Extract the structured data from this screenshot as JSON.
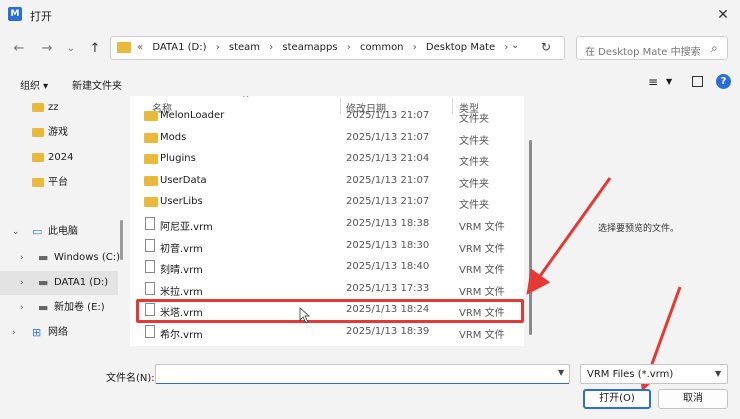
{
  "window": {
    "title": "打开",
    "app_icon_glyph": "M",
    "close_glyph": "✕"
  },
  "nav": {
    "back": "←",
    "forward": "→",
    "recent": "⌄",
    "up": "↑"
  },
  "address": {
    "crumbs": [
      "«",
      "DATA1 (D:)",
      "›",
      "steam",
      "›",
      "steamapps",
      "›",
      "common",
      "›",
      "Desktop Mate",
      "›"
    ],
    "dropdown": "⌄",
    "refresh": "↻"
  },
  "search": {
    "placeholder": "在 Desktop Mate 中搜索",
    "icon": "⌕"
  },
  "toolbar": {
    "organize": "组织 ▾",
    "new_folder": "新建文件夹",
    "view_glyph": "≡",
    "view_dd": "▼",
    "help_glyph": "?"
  },
  "sidebar": {
    "items": [
      {
        "label": "zz",
        "icon": "folder",
        "arrow": ""
      },
      {
        "label": "游戏",
        "icon": "folder",
        "arrow": ""
      },
      {
        "label": "2024",
        "icon": "folder",
        "arrow": ""
      },
      {
        "label": "平台",
        "icon": "folder",
        "arrow": ""
      },
      {
        "label": "此电脑",
        "icon": "computer",
        "arrow": "⌄"
      },
      {
        "label": "Windows (C:)",
        "icon": "drive",
        "arrow": "›"
      },
      {
        "label": "DATA1 (D:)",
        "icon": "drive",
        "arrow": "›"
      },
      {
        "label": "新加卷 (E:)",
        "icon": "drive",
        "arrow": "›"
      },
      {
        "label": "网络",
        "icon": "network",
        "arrow": "›"
      }
    ]
  },
  "list": {
    "headers": {
      "name": "名称",
      "date": "修改日期",
      "type": "类型"
    },
    "sort_glyph": "^",
    "rows": [
      {
        "name": "MelonLoader",
        "date": "2025/1/13 21:07",
        "type": "文件夹",
        "kind": "folder"
      },
      {
        "name": "Mods",
        "date": "2025/1/13 21:07",
        "type": "文件夹",
        "kind": "folder"
      },
      {
        "name": "Plugins",
        "date": "2025/1/13 21:04",
        "type": "文件夹",
        "kind": "folder"
      },
      {
        "name": "UserData",
        "date": "2025/1/13 21:07",
        "type": "文件夹",
        "kind": "folder"
      },
      {
        "name": "UserLibs",
        "date": "2025/1/13 21:07",
        "type": "文件夹",
        "kind": "folder"
      },
      {
        "name": "阿尼亚.vrm",
        "date": "2025/1/13 18:38",
        "type": "VRM 文件",
        "kind": "file"
      },
      {
        "name": "初音.vrm",
        "date": "2025/1/13 18:30",
        "type": "VRM 文件",
        "kind": "file"
      },
      {
        "name": "刻晴.vrm",
        "date": "2025/1/13 18:40",
        "type": "VRM 文件",
        "kind": "file"
      },
      {
        "name": "米拉.vrm",
        "date": "2025/1/13 17:33",
        "type": "VRM 文件",
        "kind": "file"
      },
      {
        "name": "米塔.vrm",
        "date": "2025/1/13 18:24",
        "type": "VRM 文件",
        "kind": "file"
      },
      {
        "name": "希尔.vrm",
        "date": "2025/1/13 18:39",
        "type": "VRM 文件",
        "kind": "file"
      }
    ]
  },
  "preview": {
    "text": "选择要预览的文件。"
  },
  "footer": {
    "filename_label": "文件名(N):",
    "filename_value": "",
    "filename_dd": "▼",
    "filter": "VRM Files (*.vrm)",
    "filter_dd": "▼",
    "open": "打开(O)",
    "cancel": "取消"
  },
  "colors": {
    "accent": "#2b6fd6",
    "annotation": "#e53935",
    "folder": "#e8b93b"
  }
}
